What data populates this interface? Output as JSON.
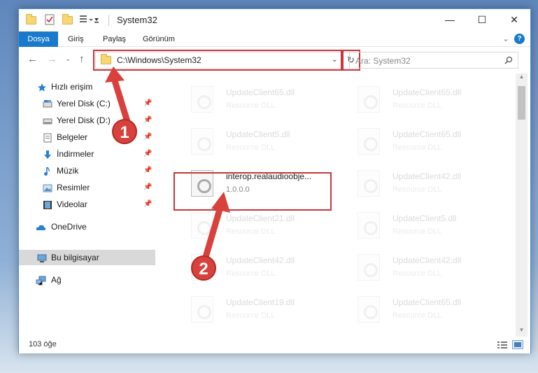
{
  "window": {
    "title": "System32",
    "controls": {
      "minimize": "—",
      "maximize": "☐",
      "close": "✕"
    }
  },
  "ribbon": {
    "tabs": [
      "Dosya",
      "Giriş",
      "Paylaş",
      "Görünüm"
    ],
    "help": "?"
  },
  "nav": {
    "address": "C:\\Windows\\System32",
    "search_placeholder": "Ara: System32"
  },
  "sidebar": {
    "quick_access": "Hızlı erişim",
    "items": [
      {
        "label": "Yerel Disk (C:)",
        "icon": "drive-icon",
        "pinned": true
      },
      {
        "label": "Yerel Disk (D:)",
        "icon": "drive-icon",
        "pinned": true
      },
      {
        "label": "Belgeler",
        "icon": "documents-icon",
        "pinned": true
      },
      {
        "label": "İndirmeler",
        "icon": "download-icon",
        "pinned": true
      },
      {
        "label": "Müzik",
        "icon": "music-icon",
        "pinned": true
      },
      {
        "label": "Resimler",
        "icon": "pictures-icon",
        "pinned": true
      },
      {
        "label": "Videolar",
        "icon": "videos-icon",
        "pinned": true
      }
    ],
    "onedrive": "OneDrive",
    "this_pc": "Bu bilgisayar",
    "network": "Ağ"
  },
  "files": {
    "left": [
      {
        "name": "UpdateClient65.dll",
        "desc": "Resource DLL"
      },
      {
        "name": "UpdateClient5.dll",
        "desc": "Resource DLL"
      },
      {
        "name": "interop.realaudioobje...",
        "desc": "1.0.0.0"
      },
      {
        "name": "UpdateClient21.dll",
        "desc": "Resource DLL"
      },
      {
        "name": "UpdateClient42.dll",
        "desc": "Resource DLL"
      },
      {
        "name": "UpdateClient19.dll",
        "desc": "Resource DLL"
      }
    ],
    "right": [
      {
        "name": "UpdateClient65.dll",
        "desc": "Resource DLL"
      },
      {
        "name": "UpdateClient65.dll",
        "desc": "Resource DLL"
      },
      {
        "name": "UpdateClient42.dll",
        "desc": "Resource DLL"
      },
      {
        "name": "UpdateClient5.dll",
        "desc": "Resource DLL"
      },
      {
        "name": "UpdateClient42.dll",
        "desc": "Resource DLL"
      },
      {
        "name": "UpdateClient65.dll",
        "desc": "Resource DLL"
      }
    ]
  },
  "status": {
    "count": "103 öğe"
  },
  "callouts": [
    "1",
    "2"
  ],
  "colors": {
    "accent": "#1979ca",
    "highlight": "#c9353a",
    "callout": "#d8413c"
  }
}
